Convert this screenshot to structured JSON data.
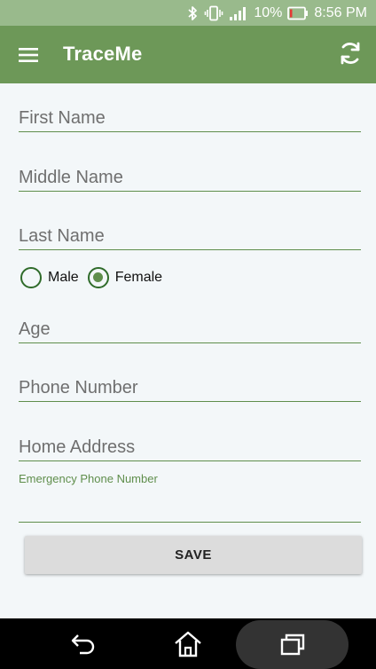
{
  "status_bar": {
    "battery": "10%",
    "time": "8:56 PM",
    "icons": [
      "bluetooth-icon",
      "vibrate-icon",
      "signal-icon",
      "battery-icon"
    ]
  },
  "app_bar": {
    "title": "TraceMe",
    "left_icon": "menu-icon",
    "right_icon": "refresh-icon"
  },
  "form": {
    "first_name": {
      "placeholder": "First Name",
      "value": ""
    },
    "middle_name": {
      "placeholder": "Middle Name",
      "value": ""
    },
    "last_name": {
      "placeholder": "Last Name",
      "value": ""
    },
    "gender": {
      "options": [
        {
          "label": "Male",
          "selected": false
        },
        {
          "label": "Female",
          "selected": true
        }
      ]
    },
    "age": {
      "placeholder": "Age",
      "value": ""
    },
    "phone_number": {
      "placeholder": "Phone Number",
      "value": ""
    },
    "home_address": {
      "placeholder": "Home Address",
      "value": ""
    },
    "emergency_phone": {
      "label": "Emergency Phone Number",
      "value": ""
    },
    "save_label": "SAVE"
  },
  "nav_bar": {
    "icons": [
      "back-icon",
      "home-icon",
      "recents-icon"
    ]
  },
  "colors": {
    "status_bar": "#99ba8c",
    "app_bar": "#6d9858",
    "accent": "#5f8e4c",
    "radio_border": "#2f6b2a",
    "background": "#f3f7f9",
    "button": "#dcdcdc"
  }
}
